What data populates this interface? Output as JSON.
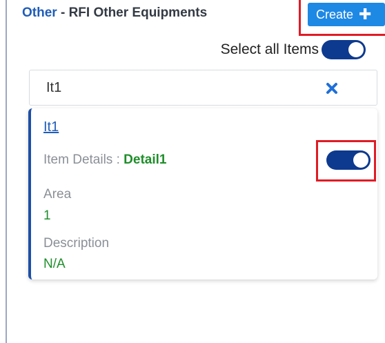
{
  "header": {
    "category": "Other",
    "separator": " - ",
    "title": "RFI Other Equipments",
    "create_label": "Create",
    "create_icon": "plus-icon"
  },
  "select_all": {
    "label": "Select all Items",
    "checked": true
  },
  "search": {
    "value": "It1",
    "clear_icon": "close-icon"
  },
  "items": [
    {
      "title": "It1",
      "details_label": "Item Details : ",
      "details_value": "Detail1",
      "selected": true,
      "area_label": "Area",
      "area_value": "1",
      "description_label": "Description",
      "description_value": "N/A"
    }
  ],
  "colors": {
    "accent": "#1e88e5",
    "toggle_on": "#0d3a8f",
    "value_green": "#1e8e2a",
    "highlight_red": "#e01b24",
    "card_border": "#1d4fa8"
  }
}
